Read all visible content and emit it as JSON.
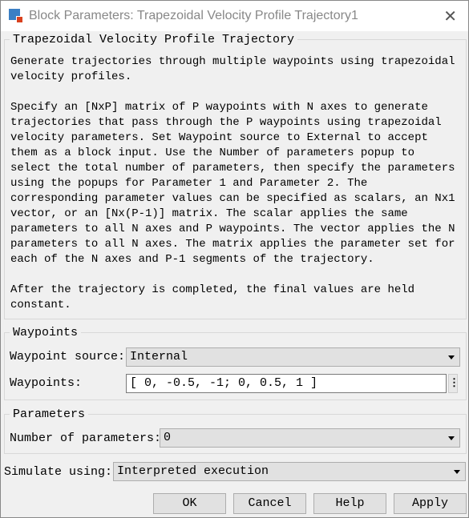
{
  "window": {
    "title": "Block Parameters: Trapezoidal Velocity Profile Trajectory1",
    "icon": "simulink-block-icon",
    "close_icon": "close-icon"
  },
  "block": {
    "title": "Trapezoidal Velocity Profile Trajectory",
    "description_lines": [
      "Generate trajectories through multiple waypoints using trapezoidal",
      "velocity profiles.",
      "",
      "Specify an [NxP] matrix of P waypoints with N axes to generate",
      "trajectories that pass through the P waypoints using trapezoidal",
      "velocity parameters. Set Waypoint source to External to accept",
      "them as a block input. Use the Number of parameters popup to",
      "select the total number of parameters, then specify the parameters",
      "using the popups for Parameter 1 and Parameter 2. The",
      "corresponding parameter values can be specified as scalars, an Nx1",
      "vector, or an [Nx(P-1)] matrix. The scalar applies the same",
      "parameters to all N axes and P waypoints. The vector applies the N",
      "parameters to all N axes. The matrix applies the parameter set for",
      "each of the N axes and P-1 segments of the trajectory.",
      "",
      "After the trajectory is completed, the final values are held",
      "constant."
    ]
  },
  "waypoints": {
    "legend": "Waypoints",
    "source_label": "Waypoint source:",
    "source_value": "Internal",
    "waypoints_label": "Waypoints:",
    "waypoints_value": "[ 0, -0.5, -1; 0, 0.5, 1 ]",
    "more_icon": "vertical-ellipsis-icon"
  },
  "parameters": {
    "legend": "Parameters",
    "num_label": "Number of parameters:",
    "num_value": "0"
  },
  "simulate": {
    "label": "Simulate using:",
    "value": "Interpreted execution"
  },
  "buttons": {
    "ok": "OK",
    "cancel": "Cancel",
    "help": "Help",
    "apply": "Apply"
  }
}
